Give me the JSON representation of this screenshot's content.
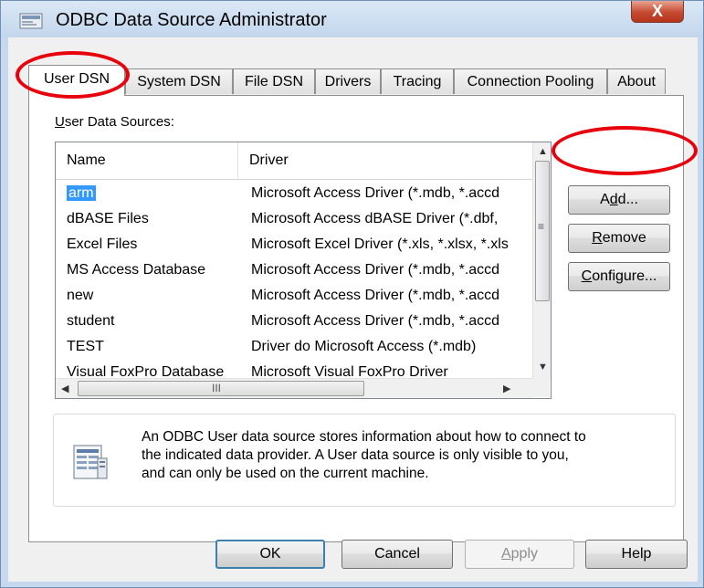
{
  "window": {
    "title": "ODBC Data Source Administrator",
    "close_label": "X"
  },
  "tabs": [
    {
      "label": "User DSN",
      "active": true
    },
    {
      "label": "System DSN",
      "active": false
    },
    {
      "label": "File DSN",
      "active": false
    },
    {
      "label": "Drivers",
      "active": false
    },
    {
      "label": "Tracing",
      "active": false
    },
    {
      "label": "Connection Pooling",
      "active": false
    },
    {
      "label": "About",
      "active": false
    }
  ],
  "user_dsn": {
    "group_label_u": "U",
    "group_label_rest": "ser Data Sources:",
    "columns": {
      "name": "Name",
      "driver": "Driver"
    },
    "rows": [
      {
        "name": "arm",
        "driver": "Microsoft Access Driver (*.mdb, *.accd",
        "selected": true
      },
      {
        "name": "dBASE Files",
        "driver": "Microsoft Access dBASE Driver (*.dbf,"
      },
      {
        "name": "Excel Files",
        "driver": "Microsoft Excel Driver (*.xls, *.xlsx, *.xls"
      },
      {
        "name": "MS Access Database",
        "driver": "Microsoft Access Driver (*.mdb, *.accd"
      },
      {
        "name": "new",
        "driver": "Microsoft Access Driver (*.mdb, *.accd"
      },
      {
        "name": "student",
        "driver": "Microsoft Access Driver (*.mdb, *.accd"
      },
      {
        "name": "TEST",
        "driver": "Driver do Microsoft Access (*.mdb)"
      },
      {
        "name": "Visual FoxPro Database",
        "driver": "Microsoft Visual FoxPro Driver"
      }
    ],
    "scroll_grip": "≡",
    "h_grip": "III",
    "buttons": {
      "add_pre": "A",
      "add_u": "d",
      "add_post": "d...",
      "remove_u": "R",
      "remove_rest": "emove",
      "configure_u": "C",
      "configure_rest": "onfigure..."
    },
    "info_lines": [
      "An ODBC User data source stores information about how to connect to",
      "the indicated data provider.   A User data source is only visible to you,",
      "and can only be used on the current machine."
    ]
  },
  "footer": {
    "ok": "OK",
    "cancel": "Cancel",
    "apply_u": "A",
    "apply_rest": "pply",
    "help": "Help"
  },
  "annotation_color": "#e8000c",
  "accent_color": "#3399ff"
}
